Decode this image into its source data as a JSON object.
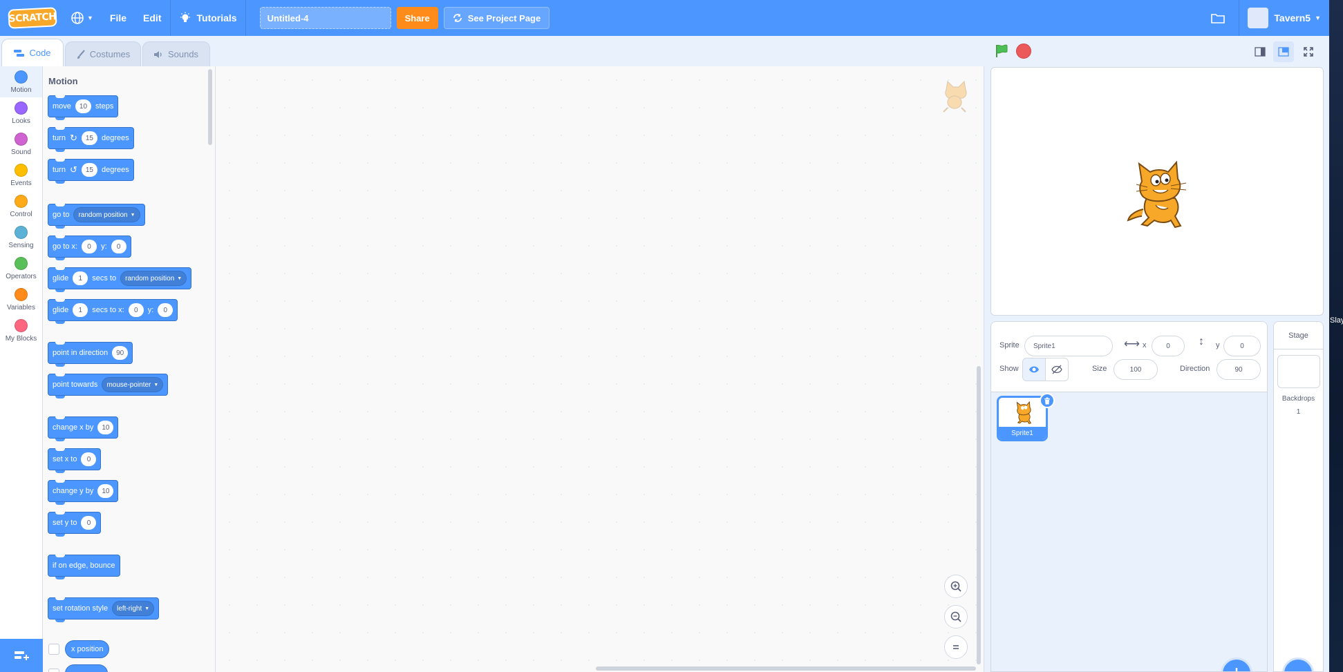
{
  "menubar": {
    "logo": "SCRATCH",
    "file": "File",
    "edit": "Edit",
    "tutorials": "Tutorials",
    "project_title": "Untitled-4",
    "share": "Share",
    "see_project_page": "See Project Page",
    "username": "Tavern5"
  },
  "tabs": {
    "code": "Code",
    "costumes": "Costumes",
    "sounds": "Sounds"
  },
  "categories": [
    {
      "label": "Motion",
      "color": "#4c97ff"
    },
    {
      "label": "Looks",
      "color": "#9966ff"
    },
    {
      "label": "Sound",
      "color": "#cf63cf"
    },
    {
      "label": "Events",
      "color": "#ffbf00"
    },
    {
      "label": "Control",
      "color": "#ffab19"
    },
    {
      "label": "Sensing",
      "color": "#5cb1d6"
    },
    {
      "label": "Operators",
      "color": "#59c059"
    },
    {
      "label": "Variables",
      "color": "#ff8c1a"
    },
    {
      "label": "My Blocks",
      "color": "#ff6680"
    }
  ],
  "palette": {
    "heading": "Motion",
    "move": {
      "t1": "move",
      "v1": "10",
      "t2": "steps"
    },
    "turn_right": {
      "t1": "turn",
      "v1": "15",
      "t2": "degrees"
    },
    "turn_left": {
      "t1": "turn",
      "v1": "15",
      "t2": "degrees"
    },
    "goto": {
      "t1": "go to",
      "d1": "random position"
    },
    "goto_xy": {
      "t1": "go to x:",
      "v1": "0",
      "t2": "y:",
      "v2": "0"
    },
    "glide_to": {
      "t1": "glide",
      "v1": "1",
      "t2": "secs to",
      "d1": "random position"
    },
    "glide_xy": {
      "t1": "glide",
      "v1": "1",
      "t2": "secs to x:",
      "v2": "0",
      "t3": "y:",
      "v3": "0"
    },
    "point_dir": {
      "t1": "point in direction",
      "v1": "90"
    },
    "point_towards": {
      "t1": "point towards",
      "d1": "mouse-pointer"
    },
    "change_x": {
      "t1": "change x by",
      "v1": "10"
    },
    "set_x": {
      "t1": "set x to",
      "v1": "0"
    },
    "change_y": {
      "t1": "change y by",
      "v1": "10"
    },
    "set_y": {
      "t1": "set y to",
      "v1": "0"
    },
    "bounce": {
      "t1": "if on edge, bounce"
    },
    "rotation": {
      "t1": "set rotation style",
      "d1": "left-right"
    },
    "x_position": "x position"
  },
  "sprite_info": {
    "sprite_label": "Sprite",
    "sprite_name": "Sprite1",
    "x_label": "x",
    "x_value": "0",
    "y_label": "y",
    "y_value": "0",
    "show_label": "Show",
    "size_label": "Size",
    "size_value": "100",
    "direction_label": "Direction",
    "direction_value": "90"
  },
  "sprites": [
    {
      "name": "Sprite1"
    }
  ],
  "stage_pane": {
    "title": "Stage",
    "backdrops_label": "Backdrops",
    "backdrops_count": "1"
  },
  "desktop": {
    "label": "Slay"
  },
  "colors": {
    "accent": "#4c97ff",
    "share": "#ff8c1a",
    "stop": "#ec5959",
    "flag": "#4cbf56"
  }
}
